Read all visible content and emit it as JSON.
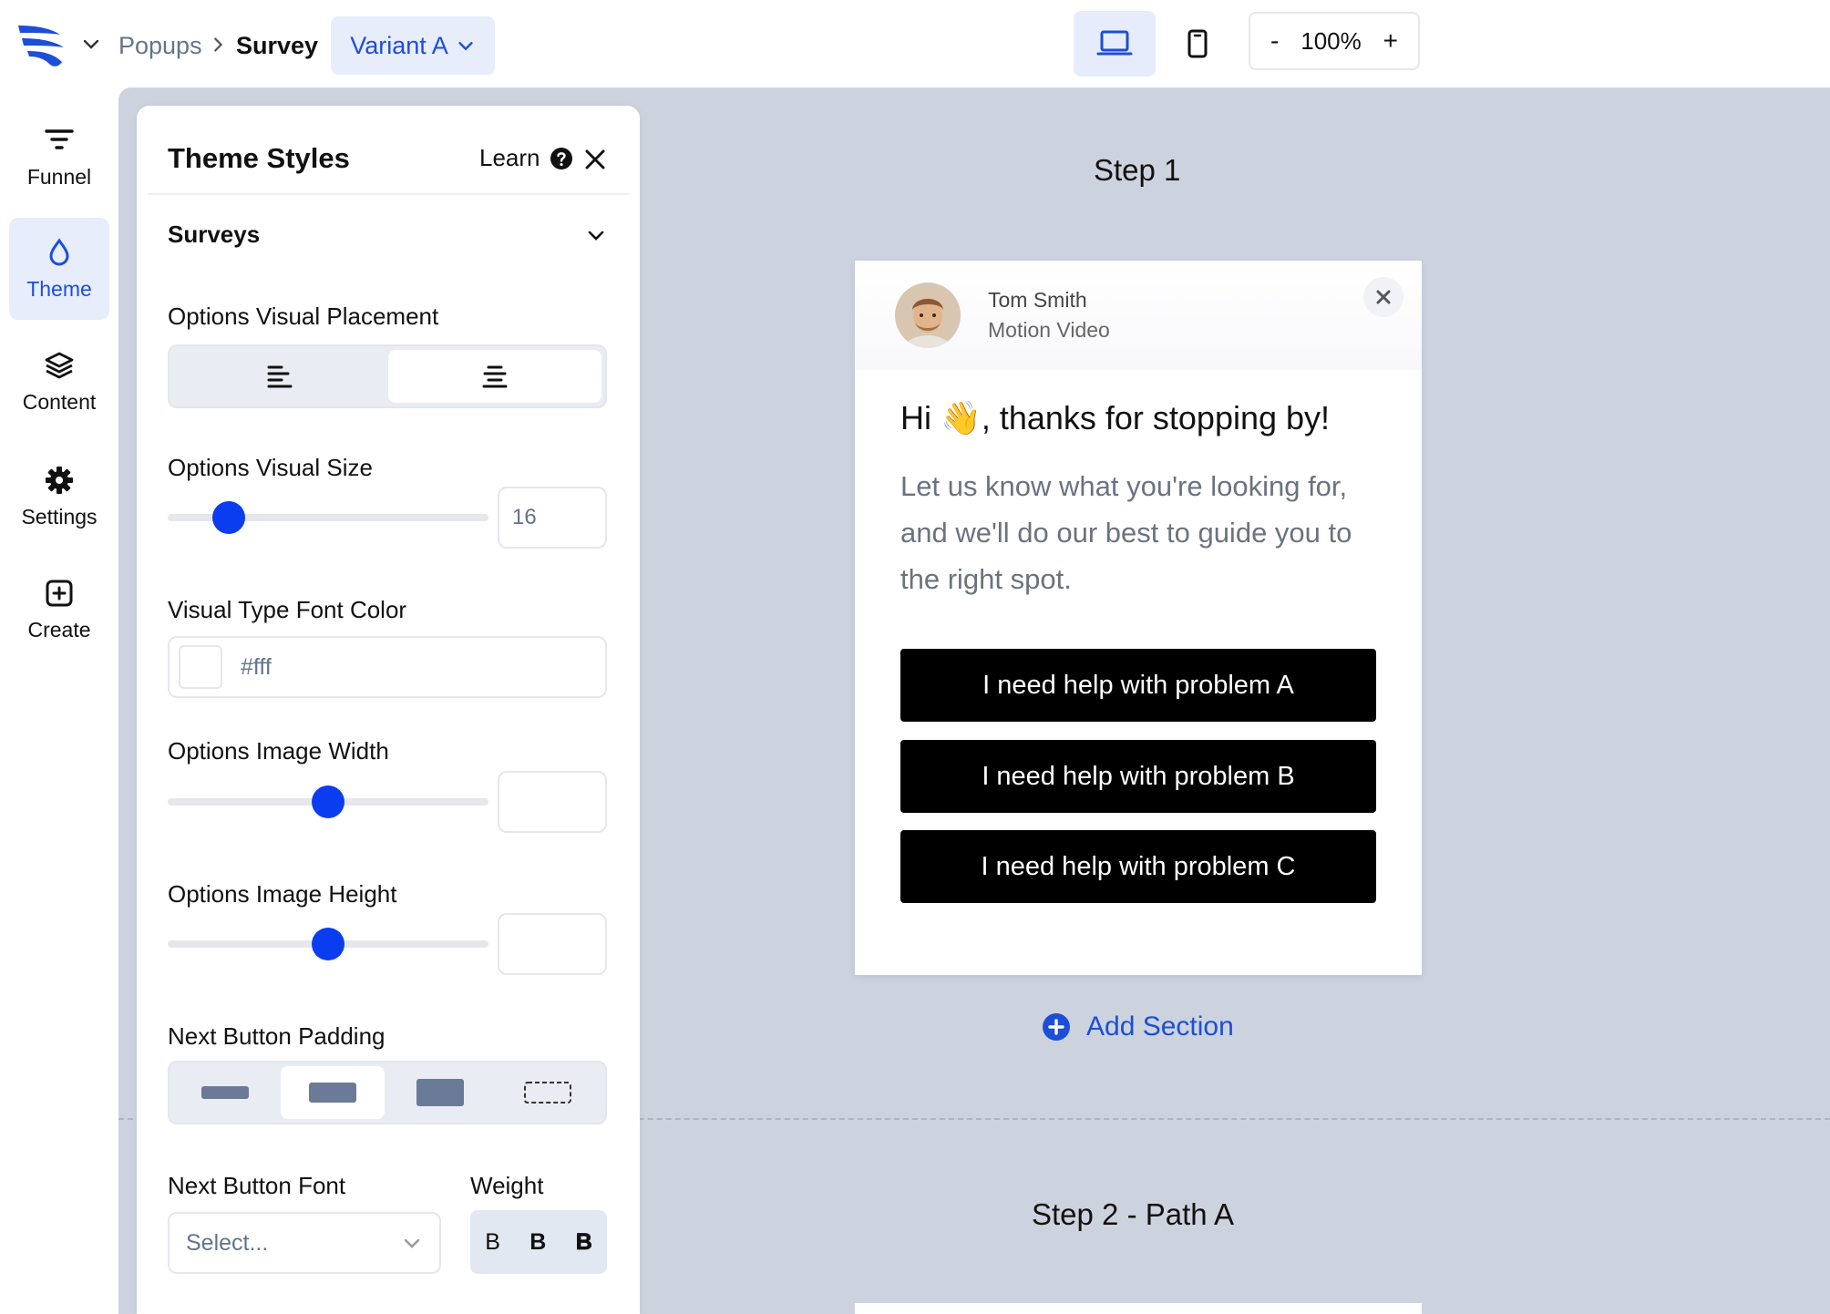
{
  "header": {
    "breadcrumb_parent": "Popups",
    "breadcrumb_current": "Survey",
    "variant_label": "Variant A",
    "zoom_minus": "-",
    "zoom_level": "100%",
    "zoom_plus": "+"
  },
  "nav": {
    "items": [
      {
        "label": "Funnel",
        "icon": "filter-icon"
      },
      {
        "label": "Theme",
        "icon": "droplet-icon",
        "active": true
      },
      {
        "label": "Content",
        "icon": "layers-icon"
      },
      {
        "label": "Settings",
        "icon": "gear-icon"
      },
      {
        "label": "Create",
        "icon": "plus-square-icon"
      }
    ]
  },
  "panel": {
    "title": "Theme Styles",
    "learn_label": "Learn",
    "section_title": "Surveys",
    "options_visual_placement_label": "Options Visual Placement",
    "options_visual_size_label": "Options Visual Size",
    "options_visual_size_value": "16",
    "options_visual_size_fraction": 0.19,
    "visual_type_font_color_label": "Visual Type Font Color",
    "visual_type_font_color_value": "#fff",
    "options_image_width_label": "Options Image Width",
    "options_image_width_fraction": 0.5,
    "options_image_height_label": "Options Image Height",
    "options_image_height_fraction": 0.5,
    "next_button_padding_label": "Next Button Padding",
    "next_button_font_label": "Next Button Font",
    "next_button_font_placeholder": "Select...",
    "weight_label": "Weight",
    "weights": [
      "B",
      "B",
      "B"
    ]
  },
  "preview": {
    "step1_label": "Step 1",
    "sender_name": "Tom Smith",
    "sender_company": "Motion Video",
    "headline": "Hi 👋, thanks for stopping by!",
    "body": "Let us know what you're looking for, and we'll do our best to guide you to the right spot.",
    "choices": [
      "I need help with problem A",
      "I need help with problem B",
      "I need help with problem C"
    ],
    "add_section_label": "Add Section",
    "step2_label": "Step 2 - Path A"
  },
  "colors": {
    "accent": "#1d4ed8",
    "slider": "#0b3df0",
    "canvas": "#cdd3de",
    "choice_button": "#000000"
  }
}
